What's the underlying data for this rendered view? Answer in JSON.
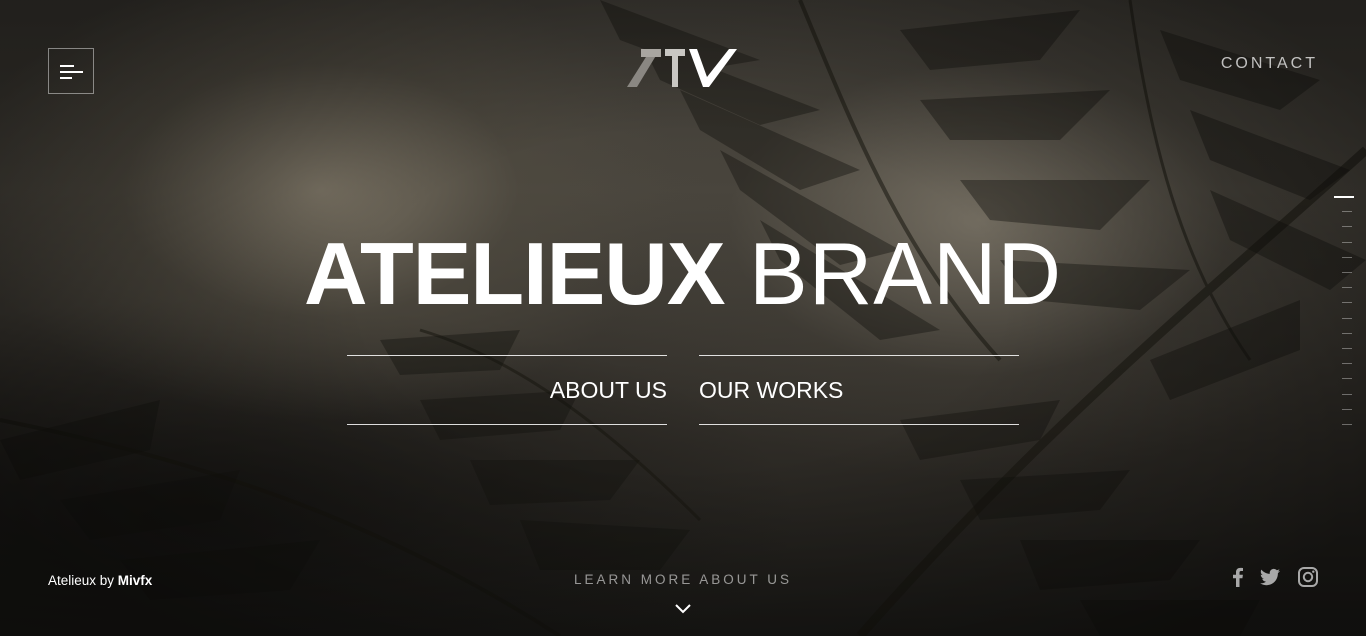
{
  "header": {
    "menu_icon": "hamburger-menu-icon",
    "logo_text": "ATV",
    "contact_label": "CONTACT"
  },
  "hero": {
    "title_bold": "ATELIEUX",
    "title_light": "BRAND",
    "nav": {
      "about_label": "ABOUT US",
      "works_label": "OUR WORKS"
    }
  },
  "footer": {
    "credit_prefix": "Atelieux by ",
    "credit_author": "Mivfx",
    "learn_more_label": "LEARN MORE ABOUT US",
    "scroll_icon": "chevron-down-icon",
    "social": [
      {
        "icon": "facebook-icon"
      },
      {
        "icon": "twitter-icon"
      },
      {
        "icon": "instagram-icon"
      }
    ]
  },
  "page_indicator": {
    "total_ticks": 16,
    "active_index": 0
  },
  "colors": {
    "text": "#ffffff",
    "muted_text": "#b7b7b7",
    "background": "#2e2b26"
  }
}
